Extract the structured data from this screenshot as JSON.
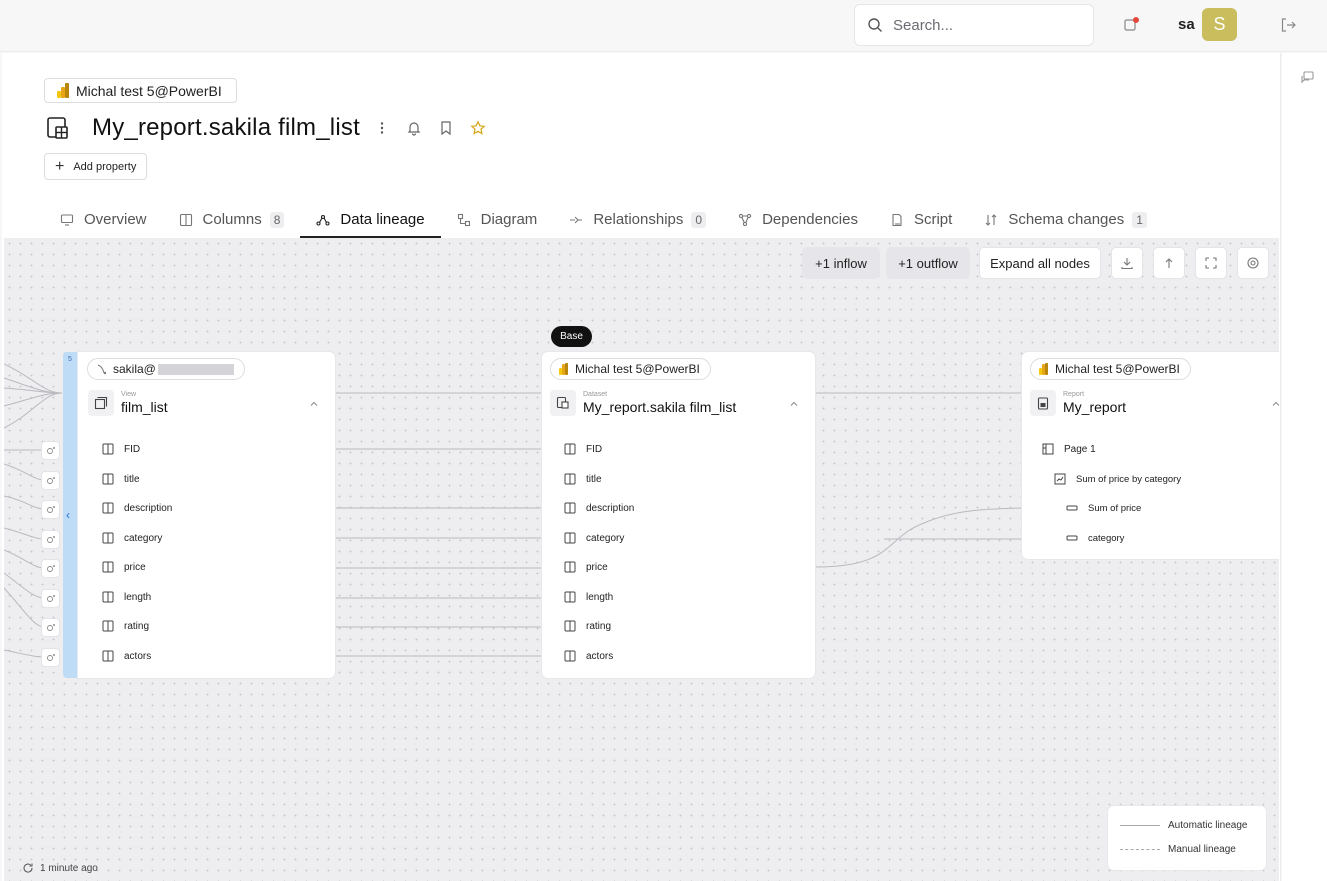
{
  "topbar": {
    "search_placeholder": "Search...",
    "username": "sa",
    "avatar_letter": "S"
  },
  "header": {
    "source_chip": "Michal test 5@PowerBI",
    "title": "My_report.sakila film_list",
    "add_property": "Add property"
  },
  "tabs": [
    {
      "label": "Overview",
      "count": ""
    },
    {
      "label": "Columns",
      "count": "8"
    },
    {
      "label": "Data lineage",
      "count": ""
    },
    {
      "label": "Diagram",
      "count": ""
    },
    {
      "label": "Relationships",
      "count": "0"
    },
    {
      "label": "Dependencies",
      "count": ""
    },
    {
      "label": "Script",
      "count": ""
    },
    {
      "label": "Schema changes",
      "count": "1"
    }
  ],
  "toolbar": {
    "inflow": "+1 inflow",
    "outflow": "+1 outflow",
    "expand": "Expand all nodes"
  },
  "base_badge": "Base",
  "nodes": {
    "view": {
      "source": "sakila@",
      "type": "View",
      "name": "film_list",
      "side_label": "5",
      "columns": [
        "FID",
        "title",
        "description",
        "category",
        "price",
        "length",
        "rating",
        "actors"
      ]
    },
    "dataset": {
      "source": "Michal test 5@PowerBI",
      "type": "Dataset",
      "name": "My_report.sakila film_list",
      "columns": [
        "FID",
        "title",
        "description",
        "category",
        "price",
        "length",
        "rating",
        "actors"
      ]
    },
    "report": {
      "source": "Michal test 5@PowerBI",
      "type": "Report",
      "name": "My_report",
      "items": [
        "Page 1",
        "Sum of price by category",
        "Sum of price",
        "category"
      ]
    }
  },
  "legend": {
    "automatic": "Automatic lineage",
    "manual": "Manual lineage"
  },
  "updated": "1 minute ago"
}
